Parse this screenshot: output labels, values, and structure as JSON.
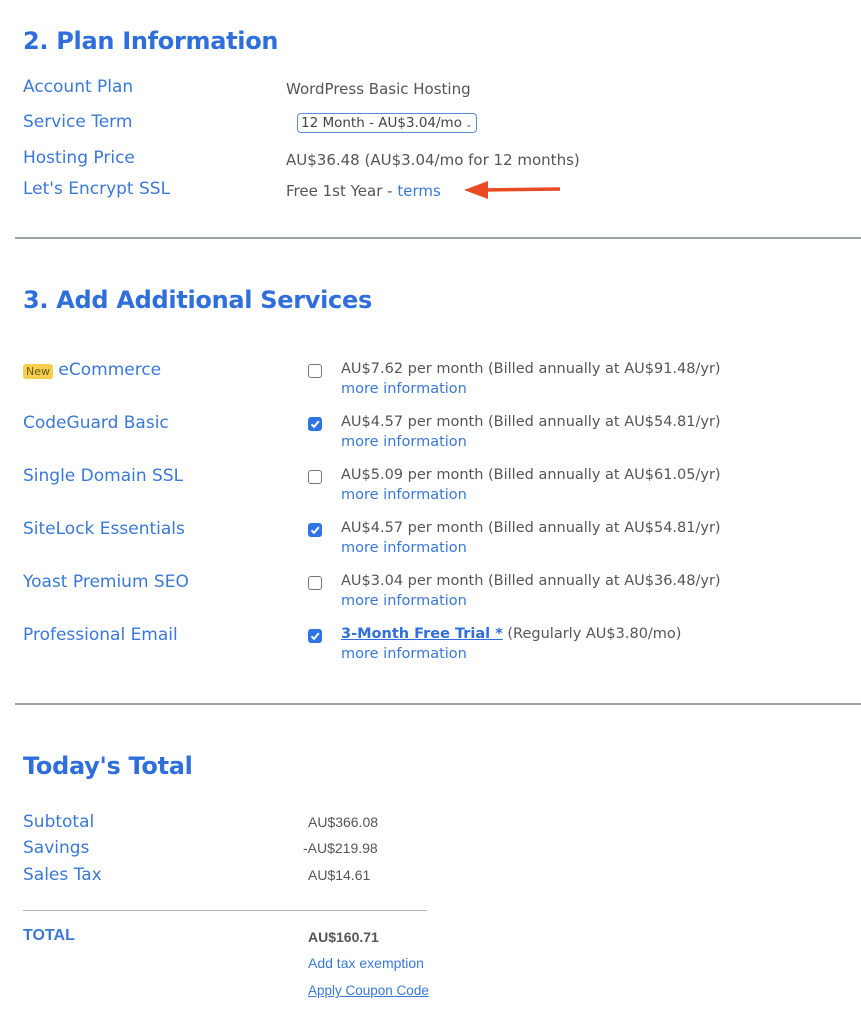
{
  "plan_section": {
    "title": "2. Plan Information",
    "rows": [
      {
        "label": "Account Plan",
        "value": "WordPress Basic Hosting"
      },
      {
        "label": "Service Term",
        "value": "12 Month - AU$3.04/mo"
      },
      {
        "label": "Hosting Price",
        "value": "AU$36.48 (AU$3.04/mo for 12 months)"
      },
      {
        "label": "Let's Encrypt SSL",
        "value": "Free 1st Year - ",
        "link": "terms"
      }
    ],
    "annotation_arrow_color": "#ea4a22"
  },
  "services_section": {
    "title": "3. Add Additional Services",
    "new_badge": "New",
    "more_info": "more information",
    "items": [
      {
        "name": "eCommerce",
        "checked": false,
        "price": "AU$7.62 per month (Billed annually at AU$91.48/yr)"
      },
      {
        "name": "CodeGuard Basic",
        "checked": true,
        "price": "AU$4.57 per month (Billed annually at AU$54.81/yr)"
      },
      {
        "name": "Single Domain SSL",
        "checked": false,
        "price": "AU$5.09 per month (Billed annually at AU$61.05/yr)"
      },
      {
        "name": "SiteLock Essentials",
        "checked": true,
        "price": "AU$4.57 per month (Billed annually at AU$54.81/yr)"
      },
      {
        "name": "Yoast Premium SEO",
        "checked": false,
        "price": "AU$3.04 per month (Billed annually at AU$36.48/yr)"
      },
      {
        "name": "Professional Email",
        "checked": true,
        "trial_link": "3-Month Free Trial *",
        "price": " (Regularly AU$3.80/mo)"
      }
    ]
  },
  "total_section": {
    "title": "Today's Total",
    "rows": [
      {
        "label": "Subtotal",
        "value": "AU$366.08"
      },
      {
        "label": "Savings",
        "value": "-AU$219.98"
      },
      {
        "label": "Sales Tax",
        "value": "AU$14.61"
      }
    ],
    "total_label": "TOTAL",
    "total_value": "AU$160.71",
    "tax_exemption_link": "Add tax exemption",
    "coupon_link": "Apply Coupon Code"
  },
  "colors": {
    "accent": "#2f6fdb",
    "checkbox": "#2f74e6",
    "badge": "#f6d04d"
  }
}
